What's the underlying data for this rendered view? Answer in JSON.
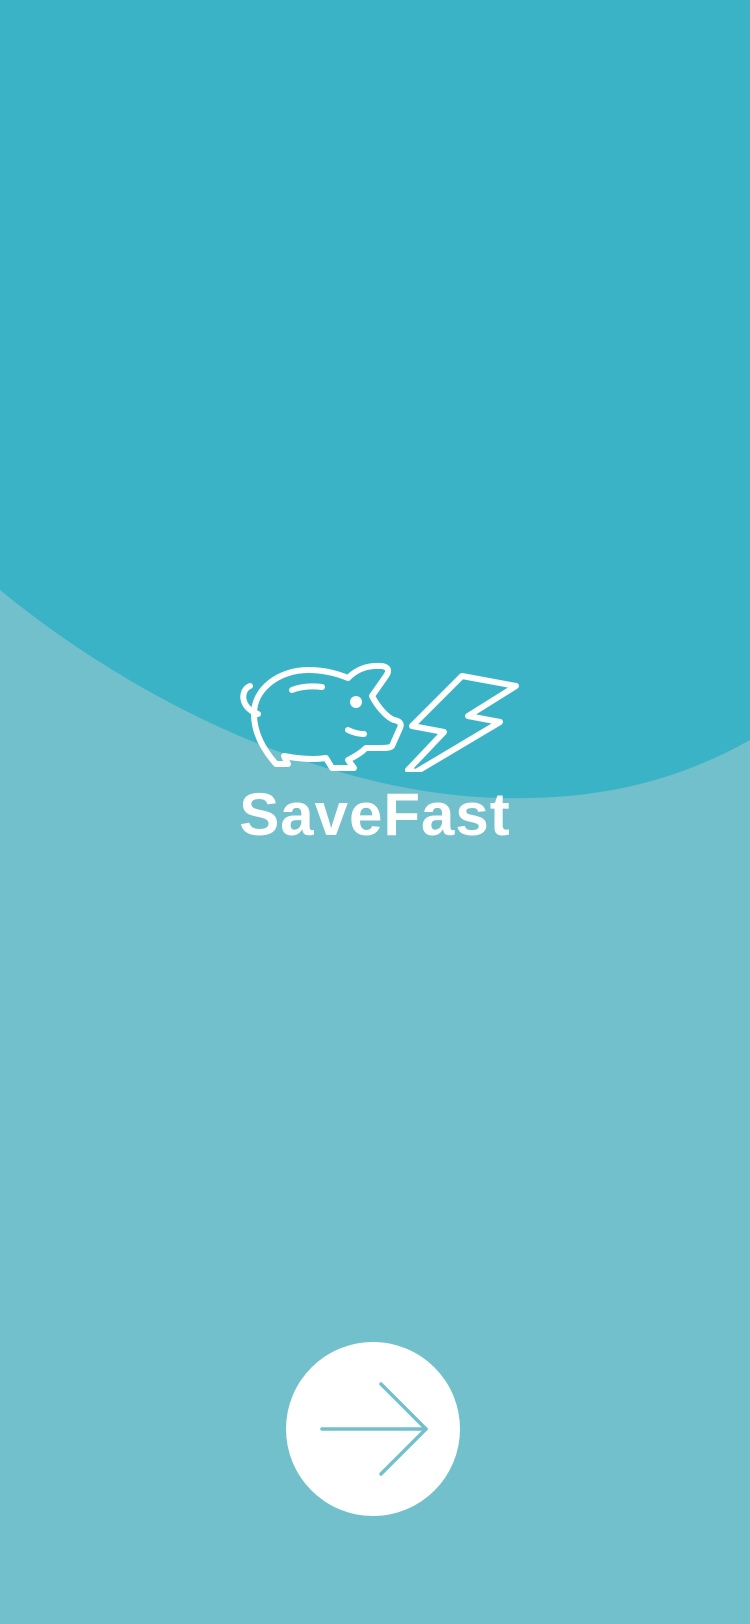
{
  "app": {
    "name": "SaveFast"
  },
  "logo": {
    "icons": [
      "piggy-bank-icon",
      "lightning-bolt-icon"
    ]
  },
  "next_button": {
    "icon": "arrow-right-icon",
    "label": ""
  },
  "colors": {
    "background": "#71c0cc",
    "top_wave": "#3bb3c6",
    "foreground": "#ffffff"
  }
}
